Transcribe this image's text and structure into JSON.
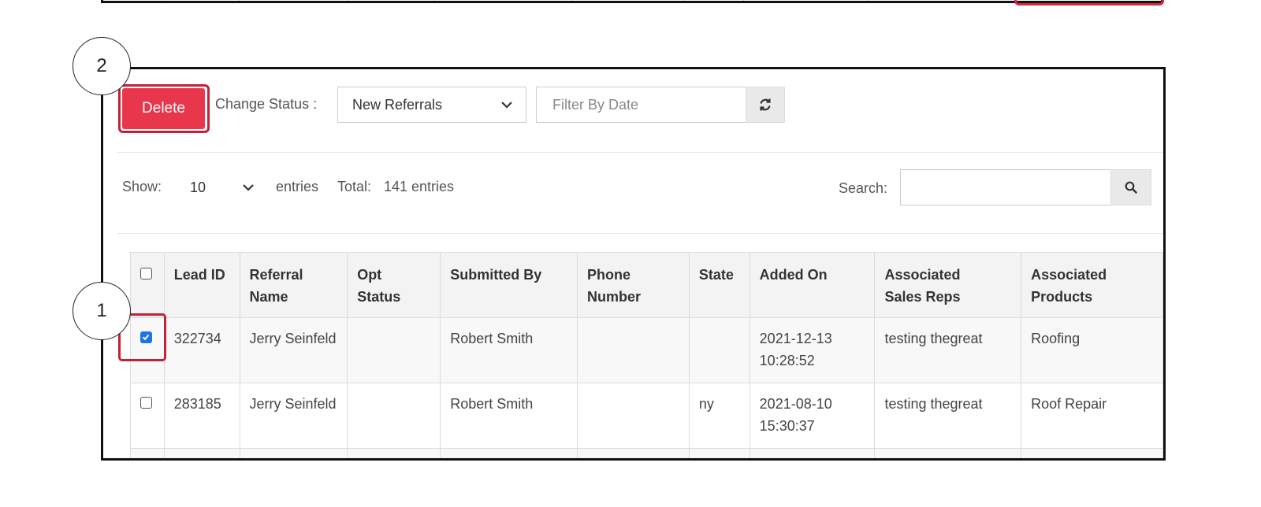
{
  "callouts": {
    "one": "1",
    "two": "2"
  },
  "toolbar": {
    "delete_label": "Delete",
    "change_status_label": "Change Status :",
    "status_select_value": "New Referrals",
    "filter_date_placeholder": "Filter By Date",
    "refresh_icon": "refresh-icon"
  },
  "list_controls": {
    "show_label": "Show:",
    "entries_value": "10",
    "entries_label": "entries",
    "total_label": "Total:",
    "total_value": "141 entries",
    "search_label": "Search:",
    "search_value": "",
    "search_icon": "search-icon"
  },
  "table": {
    "headers": [
      "",
      "Lead ID",
      "Referral Name",
      "Opt Status",
      "Submitted By",
      "Phone Number",
      "State",
      "Added On",
      "Associated Sales Reps",
      "Associated Products"
    ],
    "rows": [
      {
        "checked": true,
        "lead_id": "322734",
        "referral_name": "Jerry Seinfeld",
        "opt_status": "",
        "submitted_by": "Robert Smith",
        "phone": "",
        "state": "",
        "added_on": "2021-12-13 10:28:52",
        "sales_reps": "testing thegreat",
        "products": "Roofing"
      },
      {
        "checked": false,
        "lead_id": "283185",
        "referral_name": "Jerry Seinfeld",
        "opt_status": "",
        "submitted_by": "Robert Smith",
        "phone": "",
        "state": "ny",
        "added_on": "2021-08-10 15:30:37",
        "sales_reps": "testing thegreat",
        "products": "Roof Repair"
      }
    ]
  },
  "colors": {
    "delete_button": "#e8374d",
    "highlight": "#c4203a",
    "checkbox_checked": "#1d74e6",
    "frame_border": "#111111"
  }
}
